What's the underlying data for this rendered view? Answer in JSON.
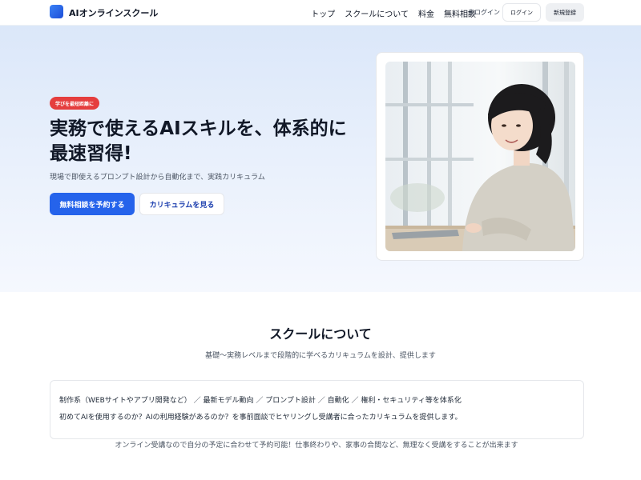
{
  "header": {
    "brand": "AIオンラインスクール",
    "nav": [
      "トップ",
      "スクールについて",
      "料金",
      "無料相談"
    ],
    "login_status": "未ログイン",
    "login_button": "ログイン",
    "register_button": "新規登録"
  },
  "hero": {
    "badge": "学びを最短距離に",
    "title_line1": "実務で使えるAIスキルを、体系的に",
    "title_line2": "最速習得!",
    "subtitle": "現場で即使えるプロンプト設計から自動化まで、実践カリキュラム",
    "primary_button": "無料相談を予約する",
    "secondary_button": "カリキュラムを見る"
  },
  "about": {
    "title": "スクールについて",
    "subtitle": "基礎〜実務レベルまで段階的に学べるカリキュラムを設計、提供します",
    "card_line1": "制作系（WEBサイトやアプリ開発など） ／ 最新モデル動向 ／ プロンプト設計 ／ 自動化 ／ 権利・セキュリティ等を体系化",
    "card_line2": "初めてAIを使用するのか？AIの利用経験があるのか？を事前面談でヒヤリングし受講者に合ったカリキュラムを提供します。",
    "footnote": "オンライン受講なので自分の予定に合わせて予約可能！仕事終わりや、家事の合間など、無理なく受講をすることが出来ます"
  },
  "colors": {
    "accent": "#2563eb",
    "badge": "#e53e3e",
    "hero_bg": "#dbe7f9"
  }
}
